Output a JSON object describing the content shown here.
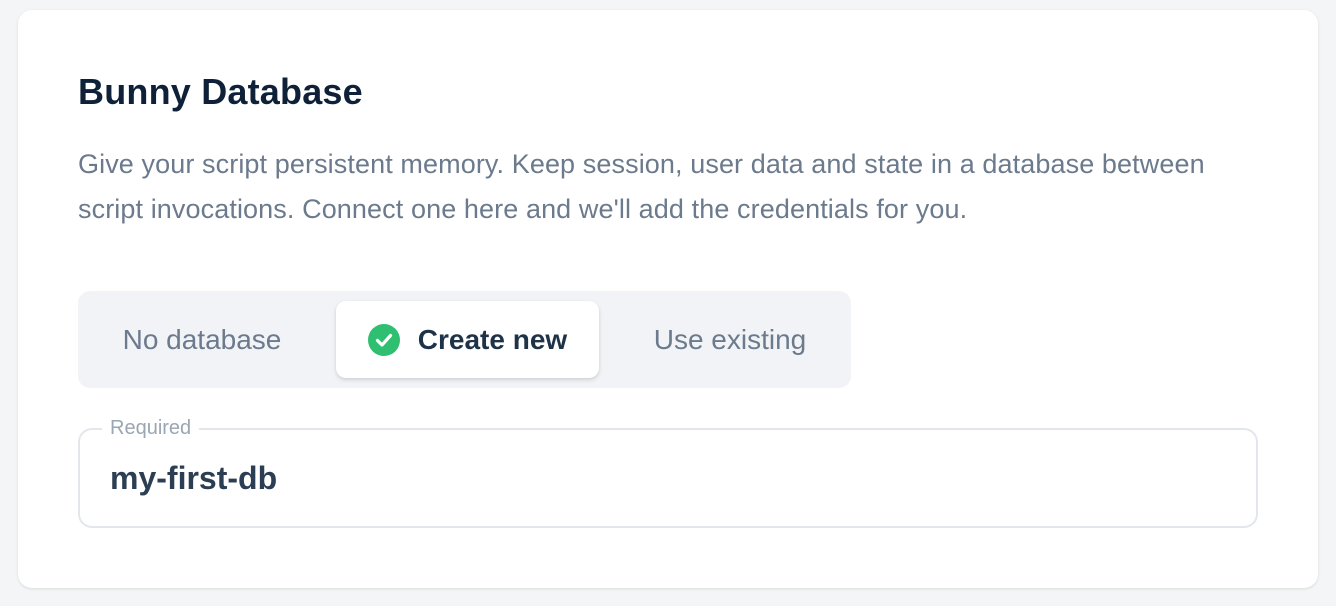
{
  "card": {
    "title": "Bunny Database",
    "description": "Give your script persistent memory. Keep session, user data and state in a database between script invocations. Connect one here and we'll add the credentials for you."
  },
  "database_mode": {
    "options": [
      {
        "label": "No database",
        "selected": false
      },
      {
        "label": "Create new",
        "selected": true
      },
      {
        "label": "Use existing",
        "selected": false
      }
    ],
    "selected_icon": "check-circle-icon"
  },
  "database_name_field": {
    "label": "Required",
    "value": "my-first-db"
  },
  "colors": {
    "accent": "#2fbf71",
    "title": "#0f2138",
    "muted_text": "#6b7a8c",
    "segment_background": "#f1f3f6",
    "field_border": "#e3e7ec"
  }
}
